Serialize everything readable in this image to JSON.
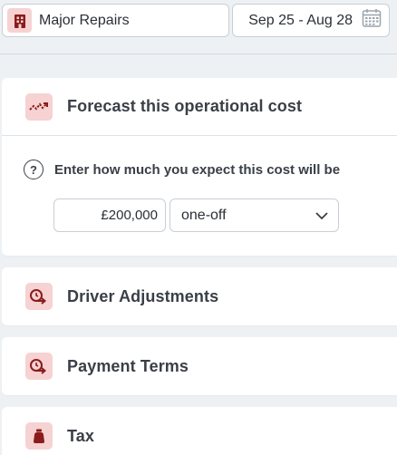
{
  "topbar": {
    "category": {
      "label": "Major Repairs",
      "icon": "building-icon"
    },
    "date_range": {
      "label": "Sep 25 - Aug 28",
      "icon": "calendar-icon"
    }
  },
  "forecast": {
    "title": "Forecast this operational cost",
    "icon": "trend-line-icon",
    "prompt": "Enter how much you expect this cost will be",
    "help_glyph": "?",
    "amount_value": "£200,000",
    "frequency": "one-off"
  },
  "sections": {
    "driver": {
      "title": "Driver Adjustments",
      "icon": "timer-arrow-icon"
    },
    "payment": {
      "title": "Payment Terms",
      "icon": "timer-arrow-icon"
    },
    "tax": {
      "title": "Tax",
      "icon": "money-bag-icon"
    }
  },
  "colors": {
    "accent": "#8a1c1c",
    "icon_bg": "#f6d2d2",
    "page_bg": "#eef1f4"
  }
}
